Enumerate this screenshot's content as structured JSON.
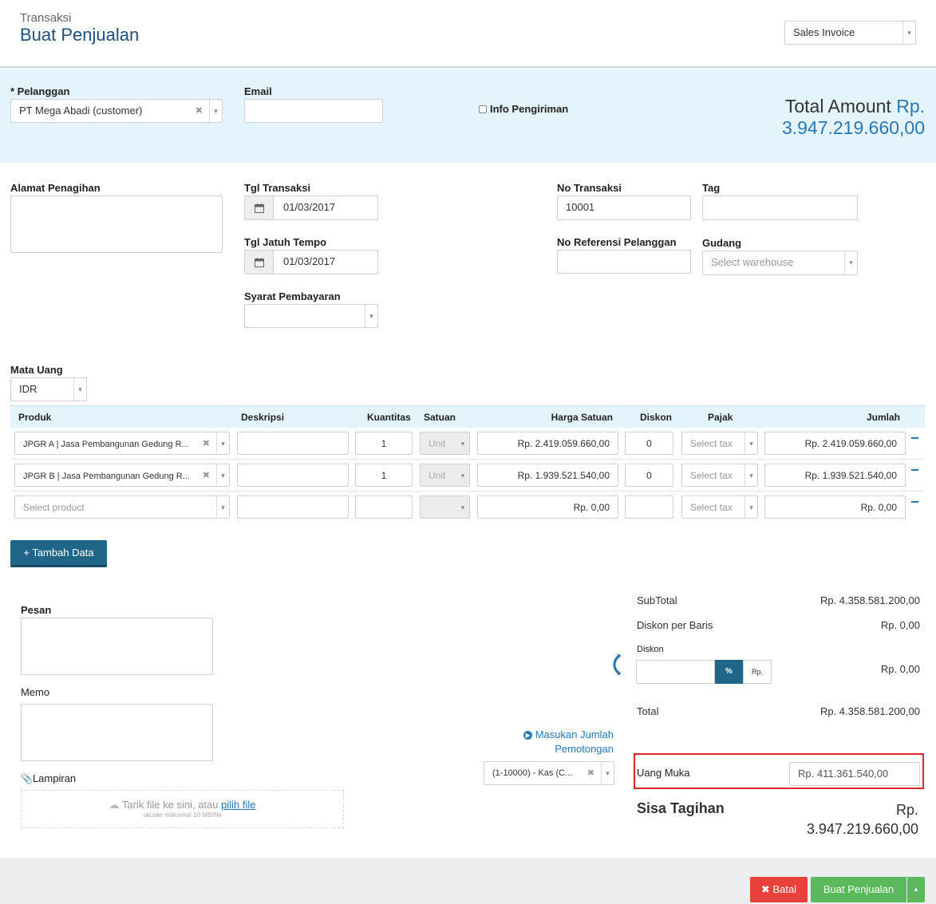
{
  "header": {
    "breadcrumb": "Transaksi",
    "title": "Buat Penjualan",
    "template_select": "Sales Invoice"
  },
  "customer_panel": {
    "customer_label": "* Pelanggan",
    "customer_value": "PT Mega Abadi (customer)",
    "email_label": "Email",
    "email_value": "",
    "shipping_label": "Info Pengiriman",
    "total_label": "Total Amount",
    "total_currency": "Rp.",
    "total_value": "3.947.219.660,00"
  },
  "details": {
    "billing_label": "Alamat Penagihan",
    "trans_date_label": "Tgl Transaksi",
    "trans_date": "01/03/2017",
    "due_date_label": "Tgl Jatuh Tempo",
    "due_date": "01/03/2017",
    "terms_label": "Syarat Pembayaran",
    "trans_no_label": "No Transaksi",
    "trans_no": "10001",
    "tag_label": "Tag",
    "ref_label": "No Referensi Pelanggan",
    "warehouse_label": "Gudang",
    "warehouse_placeholder": "Select warehouse",
    "currency_label": "Mata Uang",
    "currency": "IDR"
  },
  "table": {
    "headers": {
      "product": "Produk",
      "description": "Deskripsi",
      "quantity": "Kuantitas",
      "unit": "Satuan",
      "unit_price": "Harga Satuan",
      "discount": "Diskon",
      "tax": "Pajak",
      "amount": "Jumlah"
    },
    "rows": [
      {
        "product": "JPGR A | Jasa Pembangunan Gedung R...",
        "qty": "1",
        "unit": "Unit",
        "price": "Rp. 2.419.059.660,00",
        "discount": "0",
        "tax": "Select tax",
        "amount": "Rp. 2.419.059.660,00"
      },
      {
        "product": "JPGR B | Jasa Pembangunan Gedung R...",
        "qty": "1",
        "unit": "Unit",
        "price": "Rp. 1.939.521.540,00",
        "discount": "0",
        "tax": "Select tax",
        "amount": "Rp. 1.939.521.540,00"
      },
      {
        "product": "Select product",
        "qty": "",
        "unit": "",
        "price": "Rp. 0,00",
        "discount": "",
        "tax": "Select tax",
        "amount": "Rp. 0,00"
      }
    ],
    "add_button": "+ Tambah Data"
  },
  "notes": {
    "message_label": "Pesan",
    "memo_label": "Memo",
    "attachment_label": "Lampiran",
    "drop_text": "Tarik file ke sini, atau",
    "drop_link": "pilih file",
    "drop_hint": "ukuran maksimal 10 MB/file"
  },
  "deduction": {
    "link_line1": "Masukan Jumlah",
    "link_line2": "Pemotongan",
    "account": "(1-10000) - Kas (C..."
  },
  "summary": {
    "subtotal_label": "SubTotal",
    "subtotal": "Rp. 4.358.581.200,00",
    "line_discount_label": "Diskon per Baris",
    "line_discount": "Rp. 0,00",
    "discount_label": "Diskon",
    "discount_pct": "%",
    "discount_rp": "Rp.",
    "discount_value": "Rp. 0,00",
    "total_label": "Total",
    "total": "Rp. 4.358.581.200,00",
    "deposit_label": "Uang Muka",
    "deposit": "Rp. 411.361.540,00",
    "balance_label": "Sisa Tagihan",
    "balance_currency": "Rp.",
    "balance": "3.947.219.660,00"
  },
  "footer": {
    "cancel": "Batal",
    "submit": "Buat Penjualan"
  },
  "colors": {
    "title_blue": "#1f4f7d",
    "panel_bg": "#e4f4fc",
    "accent_blue": "#2a77b5",
    "button_dark": "#1f6689",
    "danger": "#e8403a",
    "success": "#5cb85c",
    "highlight_border": "#d9262b"
  }
}
